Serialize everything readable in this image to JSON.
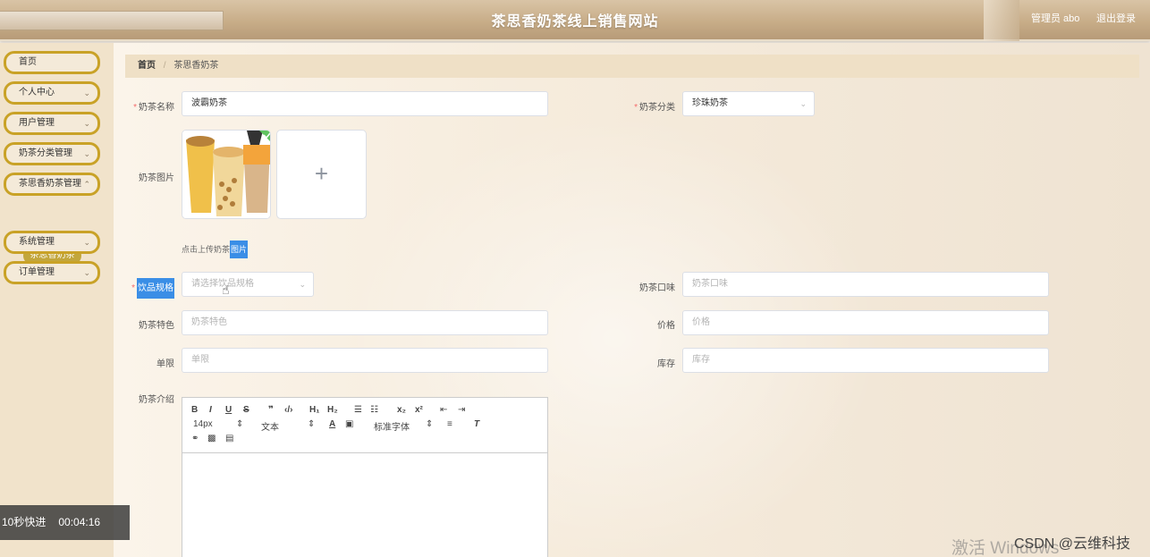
{
  "header": {
    "title": "茶思香奶茶线上销售网站",
    "user": "管理员 abo",
    "logout": "退出登录"
  },
  "sidebar": {
    "items": [
      {
        "label": "首页"
      },
      {
        "label": "个人中心"
      },
      {
        "label": "用户管理"
      },
      {
        "label": "奶茶分类管理"
      },
      {
        "label": "茶思香奶茶管理"
      },
      {
        "label": "系统管理"
      },
      {
        "label": "订单管理"
      }
    ],
    "active_sub": "茶思香奶茶"
  },
  "breadcrumb": {
    "home": "首页",
    "separator": "/",
    "current": "茶思香奶茶"
  },
  "form": {
    "name_label": "奶茶名称",
    "name_value": "波霸奶茶",
    "category_label": "奶茶分类",
    "category_value": "珍珠奶茶",
    "image_label": "奶茶图片",
    "upload_tip_a": "点击上传奶茶",
    "upload_tip_b": "图片",
    "spec_label": "饮品规格",
    "spec_placeholder": "请选择饮品规格",
    "taste_label": "奶茶口味",
    "taste_placeholder": "奶茶口味",
    "feature_label": "奶茶特色",
    "feature_placeholder": "奶茶特色",
    "price_label": "价格",
    "price_placeholder": "价格",
    "limit_label": "单限",
    "limit_placeholder": "单限",
    "stock_label": "库存",
    "stock_placeholder": "库存",
    "intro_label": "奶茶介绍"
  },
  "editor": {
    "font_size": "14px",
    "text_style": "文本",
    "font_family": "标准字体"
  },
  "overlay": {
    "speed": "10秒快进",
    "time": "00:04:16"
  },
  "watermark": "激活 Windows",
  "csdn": "CSDN @云维科技"
}
